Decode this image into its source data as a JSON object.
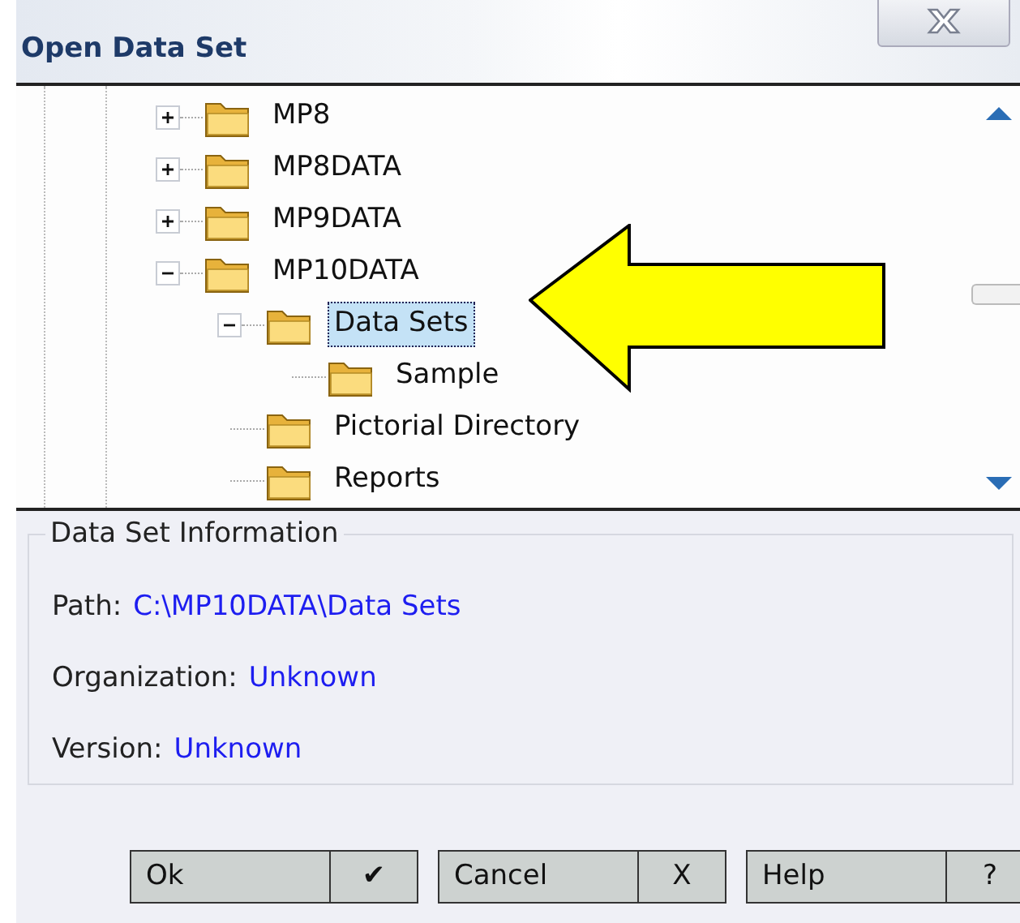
{
  "window": {
    "title": "Open Data Set"
  },
  "tree": [
    {
      "label": "MP8",
      "kind": "expandable",
      "expanded": false,
      "selected": false
    },
    {
      "label": "MP8DATA",
      "kind": "expandable",
      "expanded": false,
      "selected": false
    },
    {
      "label": "MP9DATA",
      "kind": "expandable",
      "expanded": false,
      "selected": false
    },
    {
      "label": "MP10DATA",
      "kind": "expandable",
      "expanded": true,
      "selected": false,
      "children": [
        {
          "label": "Data Sets",
          "kind": "expandable",
          "expanded": true,
          "selected": true,
          "children": [
            {
              "label": "Sample",
              "kind": "leaf",
              "selected": false
            }
          ]
        },
        {
          "label": "Pictorial Directory",
          "kind": "leaf",
          "selected": false
        },
        {
          "label": "Reports",
          "kind": "leaf",
          "selected": false
        }
      ]
    }
  ],
  "info": {
    "legend": "Data Set Information",
    "fields": [
      {
        "label": "Path:",
        "value": "C:\\MP10DATA\\Data Sets"
      },
      {
        "label": "Organization:",
        "value": "Unknown"
      },
      {
        "label": "Version:",
        "value": "Unknown"
      }
    ]
  },
  "buttons": [
    {
      "label": "Ok",
      "glyph": "✔"
    },
    {
      "label": "Cancel",
      "glyph": "X"
    },
    {
      "label": "Help",
      "glyph": "?"
    }
  ]
}
